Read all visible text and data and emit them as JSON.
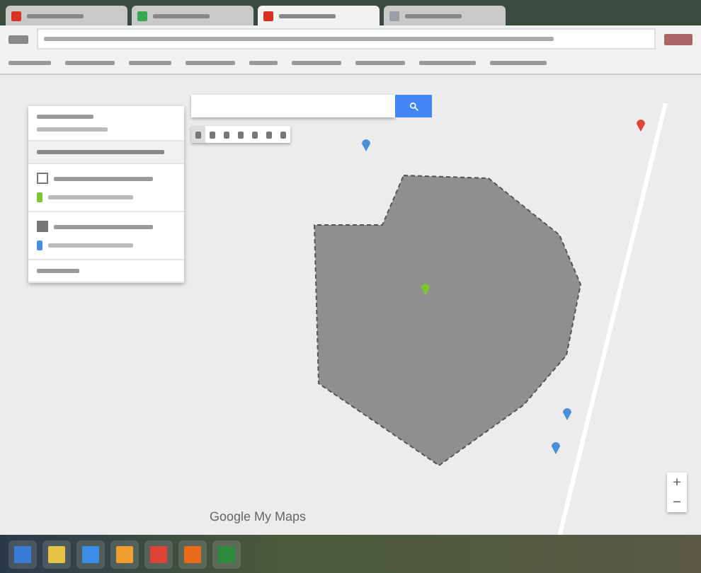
{
  "browser": {
    "tabs": [
      {
        "selected": false,
        "color": "#d93025"
      },
      {
        "selected": false,
        "color": "#34a853"
      },
      {
        "selected": true,
        "color": "#d93025"
      },
      {
        "selected": false,
        "color": "#9aa0a6"
      }
    ]
  },
  "map_panel": {
    "layers": [
      {
        "checked": false
      },
      {
        "checked": true
      }
    ]
  },
  "map_toolbar": {
    "tools": [
      {
        "selected": true
      },
      {
        "selected": false
      },
      {
        "selected": false
      },
      {
        "selected": false
      },
      {
        "selected": false
      },
      {
        "selected": false
      },
      {
        "selected": false
      }
    ]
  },
  "map": {
    "logo": "Google My Maps",
    "zoom_controls": [
      "+",
      "−"
    ]
  }
}
